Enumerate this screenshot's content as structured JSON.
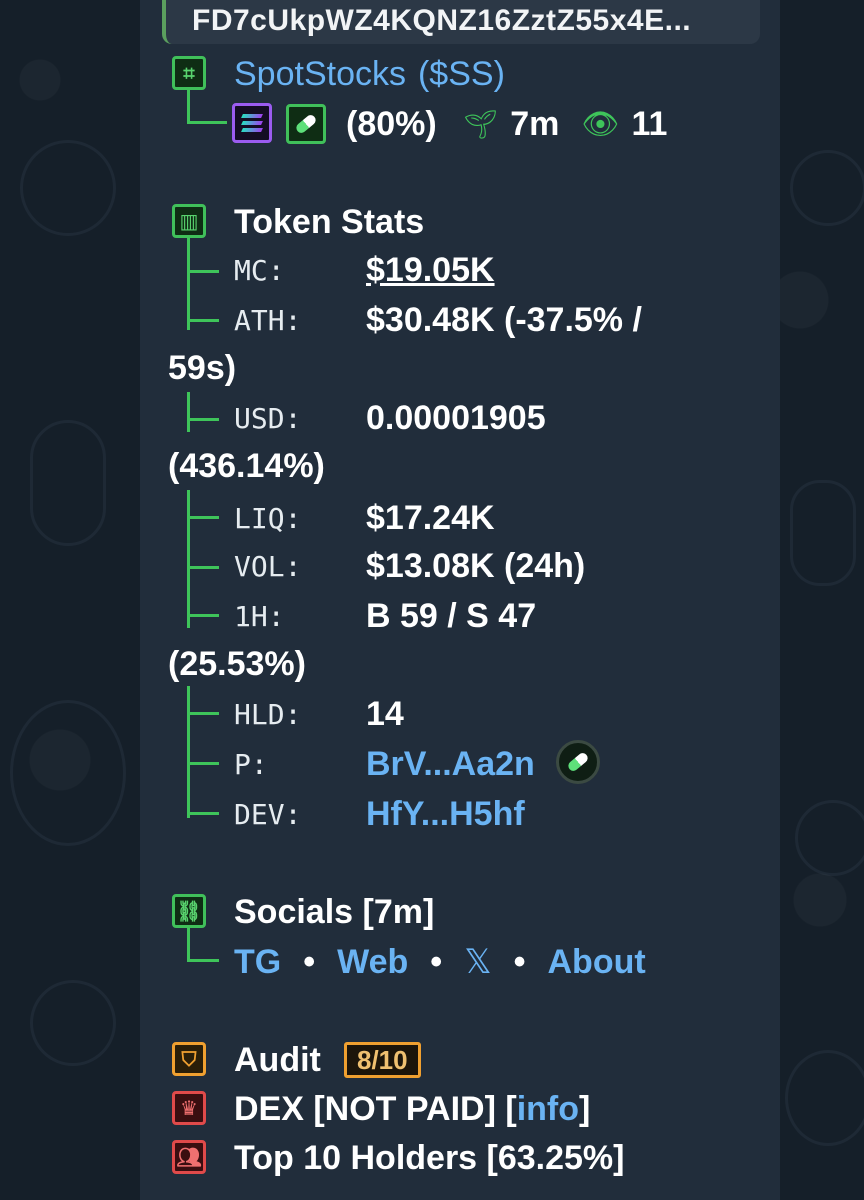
{
  "address": "FD7cUkpWZ4KQNZ16ZztZ55x4E...",
  "token": {
    "name": "SpotStocks",
    "ticker": "($SS)",
    "percent": "(80%)",
    "age": "7m",
    "views": "11"
  },
  "stats": {
    "title": "Token Stats",
    "rows": [
      {
        "label": "MC:",
        "value": "$19.05K"
      },
      {
        "label": "ATH:",
        "value": "$30.48K (-37.5% /",
        "wrap": "59s)"
      },
      {
        "label": "USD:",
        "value": "0.00001905",
        "wrap": "(436.14%)"
      },
      {
        "label": "LIQ:",
        "value": "$17.24K"
      },
      {
        "label": "VOL:",
        "value": "$13.08K (24h)"
      },
      {
        "label": "1H:",
        "value": "B 59 / S 47",
        "wrap": "(25.53%)"
      },
      {
        "label": "HLD:",
        "value": "14"
      },
      {
        "label": "P:",
        "value": "BrV...Aa2n"
      },
      {
        "label": "DEV:",
        "value": "HfY...H5hf"
      }
    ]
  },
  "socials": {
    "title": "Socials [7m]",
    "links": [
      "TG",
      "Web",
      "𝕏",
      "About"
    ],
    "separator": "•"
  },
  "audit": {
    "title": "Audit",
    "score": "8/10",
    "dex_text": "DEX [NOT PAID] [",
    "dex_link": "info",
    "dex_close": "]",
    "holders": "Top 10 Holders [63.25%]"
  },
  "colors": {
    "background": "#17212b",
    "bubble": "#212d3b",
    "link": "#6ab3f3",
    "green": "#3ec45a",
    "orange": "#f0a030",
    "red": "#e04a4a"
  }
}
